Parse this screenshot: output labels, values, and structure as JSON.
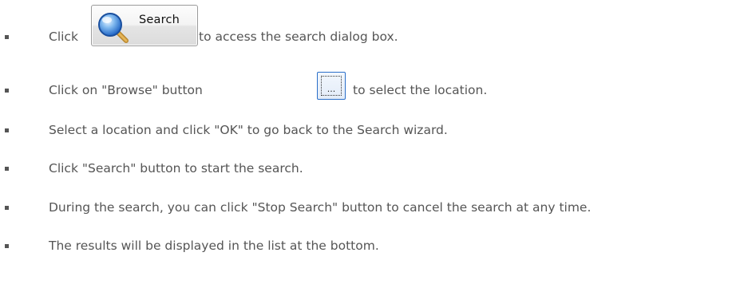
{
  "instructions": [
    {
      "before": "Click",
      "button_label": "Search",
      "after": "to access the search dialog box."
    },
    {
      "before": "Click on \"Browse\" button",
      "button_label": "...",
      "after": "to select the location."
    },
    {
      "text": "Select a location and click \"OK\" to go back to the Search wizard."
    },
    {
      "text": "Click \"Search\" button to start the search."
    },
    {
      "text": "During the search, you can click \"Stop Search\" button to cancel the search at any time."
    },
    {
      "text": "The results will be displayed in the list at the bottom."
    }
  ],
  "icons": {
    "search_button_icon": "magnifying-glass-icon",
    "bullet_icon": "square-bullet-icon"
  },
  "colors": {
    "text": "#555555",
    "browse_border": "#2a6fc9"
  }
}
